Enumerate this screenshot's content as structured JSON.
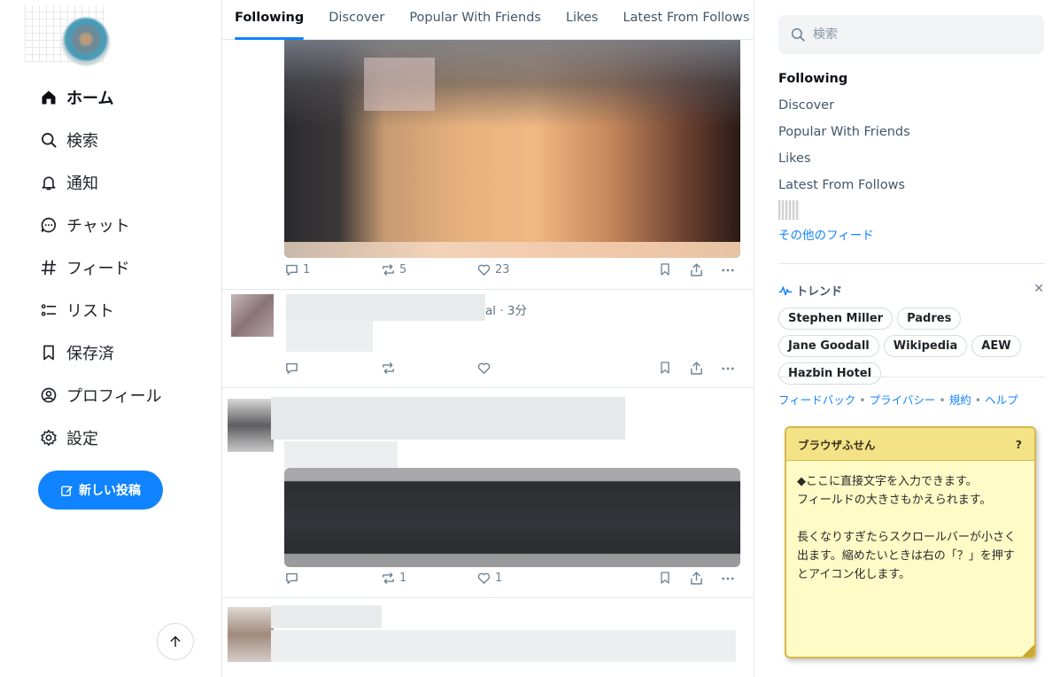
{
  "nav": {
    "items": [
      {
        "label": "ホーム",
        "icon": "home-icon",
        "active": true
      },
      {
        "label": "検索",
        "icon": "search-icon"
      },
      {
        "label": "通知",
        "icon": "bell-icon"
      },
      {
        "label": "チャット",
        "icon": "chat-icon"
      },
      {
        "label": "フィード",
        "icon": "hash-icon"
      },
      {
        "label": "リスト",
        "icon": "list-icon"
      },
      {
        "label": "保存済",
        "icon": "bookmark-icon"
      },
      {
        "label": "プロフィール",
        "icon": "profile-icon"
      },
      {
        "label": "設定",
        "icon": "gear-icon"
      }
    ],
    "new_post_label": "新しい投稿"
  },
  "tabs": [
    "Following",
    "Discover",
    "Popular With Friends",
    "Likes",
    "Latest From Follows"
  ],
  "posts": [
    {
      "replies": "1",
      "reposts": "5",
      "likes": "23"
    },
    {
      "meta": "al · 3分",
      "replies": "",
      "reposts": "",
      "likes": ""
    },
    {
      "replies": "",
      "reposts": "1",
      "likes": "1"
    }
  ],
  "right": {
    "search_placeholder": "検索",
    "feeds": [
      "Following",
      "Discover",
      "Popular With Friends",
      "Likes",
      "Latest From Follows"
    ],
    "more_feeds": "その他のフィード",
    "trend_title": "トレンド",
    "trends": [
      "Stephen Miller",
      "Padres",
      "Jane Goodall",
      "Wikipedia",
      "AEW",
      "Hazbin Hotel"
    ],
    "footer": [
      "フィードバック",
      "プライバシー",
      "規約",
      "ヘルプ"
    ]
  },
  "sticky": {
    "title": "ブラウザふせん",
    "help": "?",
    "text": "◆ここに直接文字を入力できます。\nフィールドの大きさもかえられます。\n\n長くなりすぎたらスクロールバーが小さく出ます。縮めたいときは右の「？」を押すとアイコン化します。"
  },
  "colors": {
    "accent": "#1083fe",
    "sticky_bg": "#fffbc6",
    "sticky_header": "#f4e287"
  }
}
